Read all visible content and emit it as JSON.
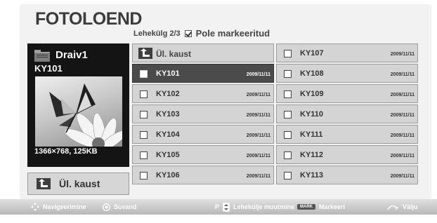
{
  "header": {
    "title": "FOTOLOEND",
    "page_indicator": "Lehekülg 2/3",
    "marked_status": "Pole markeeritud"
  },
  "left_panel": {
    "drive_name": "Draiv1",
    "file_name": "KY101",
    "photo_meta": "1366×768, 125KB",
    "up_folder_label": "Ül. kaust"
  },
  "grid": {
    "up_folder_label": "Ül. kaust",
    "col1": [
      {
        "name": "KY101",
        "date": "2009/11/11",
        "selected": true
      },
      {
        "name": "KY102",
        "date": "2009/11/11"
      },
      {
        "name": "KY103",
        "date": "2009/11/11"
      },
      {
        "name": "KY104",
        "date": "2009/11/11"
      },
      {
        "name": "KY105",
        "date": "2009/11/11"
      },
      {
        "name": "KY106",
        "date": "2009/11/11"
      }
    ],
    "col2": [
      {
        "name": "KY107",
        "date": "2009/11/11"
      },
      {
        "name": "KY108",
        "date": "2009/11/11"
      },
      {
        "name": "KY109",
        "date": "2009/11/11"
      },
      {
        "name": "KY110",
        "date": "2009/11/11"
      },
      {
        "name": "KY111",
        "date": "2009/11/11"
      },
      {
        "name": "KY112",
        "date": "2009/11/11"
      },
      {
        "name": "KY113",
        "date": "2009/11/11"
      }
    ]
  },
  "bottom_bar": {
    "navigate": "Navigeerimine",
    "select": "Suvand",
    "page_change_prefix": "P",
    "page_change": "Lehekülje muutmine",
    "mark_badge": "MARK",
    "mark": "Markeeri",
    "exit": "Välju"
  },
  "colors": {
    "selected_row": "#4b4b4b",
    "row": "#d4d4d4",
    "preview_panel": "#141414"
  }
}
